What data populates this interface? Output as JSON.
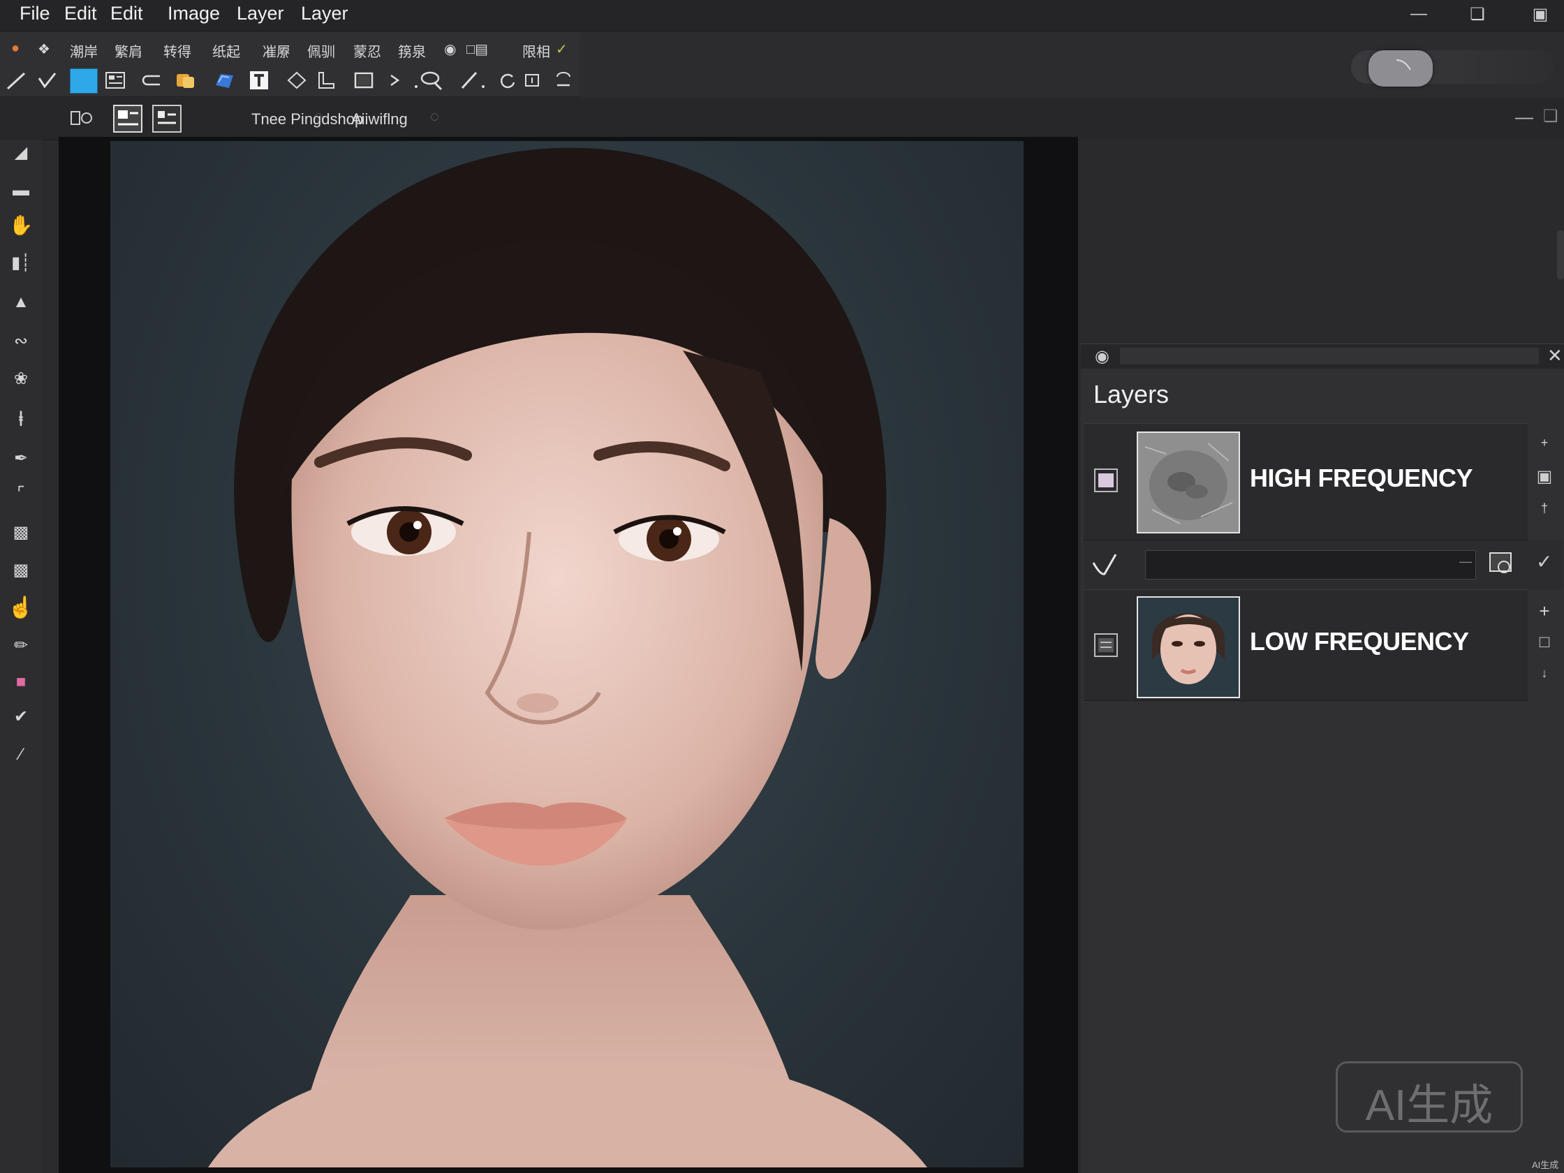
{
  "menu": {
    "items": [
      "File",
      "Edit",
      "Edit",
      "Image",
      "Layer",
      "Layer"
    ]
  },
  "window_controls": [
    "minimize-icon",
    "restore-icon",
    "maximize-icon"
  ],
  "toolbar1": {
    "labels": [
      "潮岸",
      "繁肩",
      "转得",
      "纸起",
      "凗屪",
      "佩驯",
      "蒙忍",
      "箉泉",
      "限相"
    ]
  },
  "doc_tabs": {
    "tab1": "Tnee Pingdshop",
    "tab2": "Aiiwiflng"
  },
  "colors": {
    "accent_blue": "#2ea8e8",
    "panel_bg": "#303033",
    "canvas_bg": "#101012"
  },
  "layers_panel": {
    "title": "Layers",
    "layers": [
      {
        "name": "HIGH FREQUENCY",
        "thumb": "texture"
      },
      {
        "name": "LOW FREQUENCY",
        "thumb": "portrait"
      }
    ]
  },
  "watermark": {
    "badge": "AI生成",
    "small": "AI生成"
  }
}
